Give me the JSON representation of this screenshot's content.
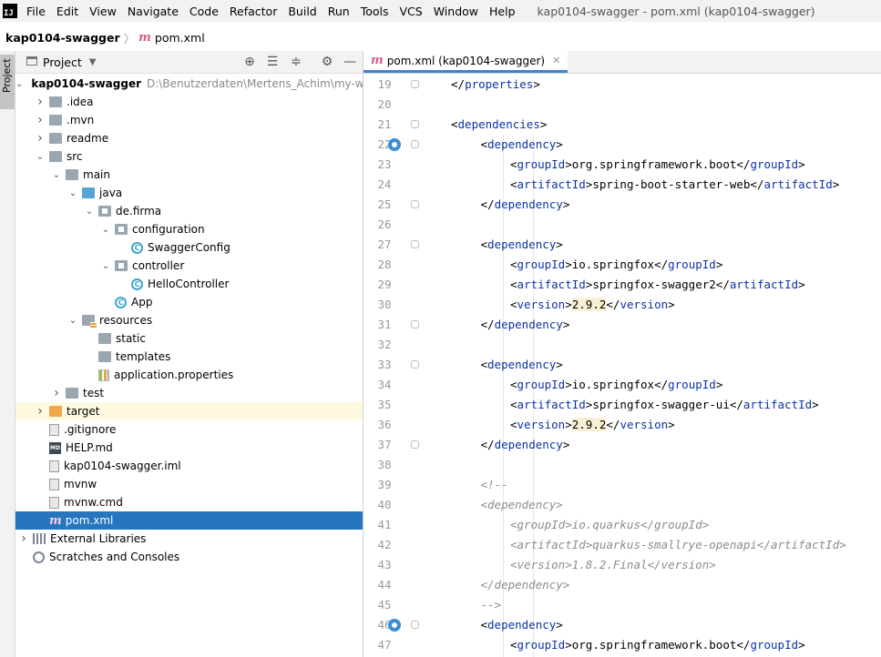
{
  "app": {
    "logo_text": "IJ",
    "menu": [
      "File",
      "Edit",
      "View",
      "Navigate",
      "Code",
      "Refactor",
      "Build",
      "Run",
      "Tools",
      "VCS",
      "Window",
      "Help"
    ],
    "window_title": "kap0104-swagger - pom.xml (kap0104-swagger)"
  },
  "breadcrumb": {
    "project": "kap0104-swagger",
    "file": "pom.xml"
  },
  "left_strip": {
    "label": "Project"
  },
  "project_panel": {
    "title": "Project"
  },
  "tree": [
    {
      "label": "kap0104-swagger",
      "path": "D:\\Benutzerdaten\\Mertens_Achim\\my-works",
      "icon": "folder",
      "expanded": true,
      "level": 0
    },
    {
      "label": ".idea",
      "icon": "folder",
      "expanded": false,
      "level": 1
    },
    {
      "label": ".mvn",
      "icon": "folder",
      "expanded": false,
      "level": 1
    },
    {
      "label": "readme",
      "icon": "folder",
      "expanded": false,
      "level": 1
    },
    {
      "label": "src",
      "icon": "folder",
      "expanded": true,
      "level": 1
    },
    {
      "label": "main",
      "icon": "folder",
      "expanded": true,
      "level": 2
    },
    {
      "label": "java",
      "icon": "folder-blue",
      "expanded": true,
      "level": 3
    },
    {
      "label": "de.firma",
      "icon": "package",
      "expanded": true,
      "level": 4
    },
    {
      "label": "configuration",
      "icon": "package",
      "expanded": true,
      "level": 5
    },
    {
      "label": "SwaggerConfig",
      "icon": "class",
      "level": 6
    },
    {
      "label": "controller",
      "icon": "package",
      "expanded": true,
      "level": 5
    },
    {
      "label": "HelloController",
      "icon": "class",
      "level": 6
    },
    {
      "label": "App",
      "icon": "class",
      "level": 5
    },
    {
      "label": "resources",
      "icon": "folder-res",
      "expanded": true,
      "level": 3
    },
    {
      "label": "static",
      "icon": "folder",
      "level": 4
    },
    {
      "label": "templates",
      "icon": "folder",
      "level": 4
    },
    {
      "label": "application.properties",
      "icon": "props",
      "level": 4
    },
    {
      "label": "test",
      "icon": "folder",
      "expanded": false,
      "level": 2
    },
    {
      "label": "target",
      "icon": "folder-orange",
      "expanded": false,
      "level": 1
    },
    {
      "label": ".gitignore",
      "icon": "file",
      "level": 1
    },
    {
      "label": "HELP.md",
      "icon": "md",
      "level": 1
    },
    {
      "label": "kap0104-swagger.iml",
      "icon": "file",
      "level": 1
    },
    {
      "label": "mvnw",
      "icon": "file",
      "level": 1
    },
    {
      "label": "mvnw.cmd",
      "icon": "file",
      "level": 1
    },
    {
      "label": "pom.xml",
      "icon": "maven",
      "level": 1,
      "selected": true
    },
    {
      "label": "External Libraries",
      "icon": "lib",
      "expanded": false,
      "level": 0
    },
    {
      "label": "Scratches and Consoles",
      "icon": "scratch",
      "level": 0
    }
  ],
  "editor": {
    "tab_label": "pom.xml (kap0104-swagger)",
    "lines": [
      {
        "n": "19",
        "indent": 2,
        "text": "</properties>",
        "kind": "tag"
      },
      {
        "n": "20",
        "indent": 0,
        "text": "",
        "kind": "tag"
      },
      {
        "n": "21",
        "indent": 2,
        "text": "<dependencies>",
        "kind": "tag"
      },
      {
        "n": "22",
        "indent": 3,
        "text": "<dependency>",
        "kind": "tag",
        "gutter": true
      },
      {
        "n": "23",
        "indent": 4,
        "tag": "groupId",
        "value": "org.springframework.boot",
        "kind": "elem"
      },
      {
        "n": "24",
        "indent": 4,
        "tag": "artifactId",
        "value": "spring-boot-starter-web",
        "kind": "elem"
      },
      {
        "n": "25",
        "indent": 3,
        "text": "</dependency>",
        "kind": "tag"
      },
      {
        "n": "26",
        "indent": 0,
        "text": "",
        "kind": "tag"
      },
      {
        "n": "27",
        "indent": 3,
        "text": "<dependency>",
        "kind": "tag"
      },
      {
        "n": "28",
        "indent": 4,
        "tag": "groupId",
        "value": "io.springfox",
        "kind": "elem"
      },
      {
        "n": "29",
        "indent": 4,
        "tag": "artifactId",
        "value": "springfox-swagger2",
        "kind": "elem"
      },
      {
        "n": "30",
        "indent": 4,
        "tag": "version",
        "value": "2.9.2",
        "kind": "elem",
        "highlight": true
      },
      {
        "n": "31",
        "indent": 3,
        "text": "</dependency>",
        "kind": "tag"
      },
      {
        "n": "32",
        "indent": 0,
        "text": "",
        "kind": "tag"
      },
      {
        "n": "33",
        "indent": 3,
        "text": "<dependency>",
        "kind": "tag"
      },
      {
        "n": "34",
        "indent": 4,
        "tag": "groupId",
        "value": "io.springfox",
        "kind": "elem"
      },
      {
        "n": "35",
        "indent": 4,
        "tag": "artifactId",
        "value": "springfox-swagger-ui",
        "kind": "elem"
      },
      {
        "n": "36",
        "indent": 4,
        "tag": "version",
        "value": "2.9.2",
        "kind": "elem",
        "highlight": true
      },
      {
        "n": "37",
        "indent": 3,
        "text": "</dependency>",
        "kind": "tag"
      },
      {
        "n": "38",
        "indent": 0,
        "text": "",
        "kind": "tag"
      },
      {
        "n": "39",
        "indent": 3,
        "text": "<!--",
        "kind": "comment"
      },
      {
        "n": "40",
        "indent": 3,
        "text": "<dependency>",
        "kind": "comment"
      },
      {
        "n": "41",
        "indent": 4,
        "text": "<groupId>io.quarkus</groupId>",
        "kind": "comment"
      },
      {
        "n": "42",
        "indent": 4,
        "text": "<artifactId>quarkus-smallrye-openapi</artifactId>",
        "kind": "comment"
      },
      {
        "n": "43",
        "indent": 4,
        "text": "<version>1.8.2.Final</version>",
        "kind": "comment"
      },
      {
        "n": "44",
        "indent": 3,
        "text": "</dependency>",
        "kind": "comment"
      },
      {
        "n": "45",
        "indent": 3,
        "text": "-->",
        "kind": "comment"
      },
      {
        "n": "46",
        "indent": 3,
        "text": "<dependency>",
        "kind": "tag",
        "gutter": true
      },
      {
        "n": "47",
        "indent": 4,
        "tag": "groupId",
        "value": "org.springframework.boot",
        "kind": "elem"
      }
    ]
  }
}
